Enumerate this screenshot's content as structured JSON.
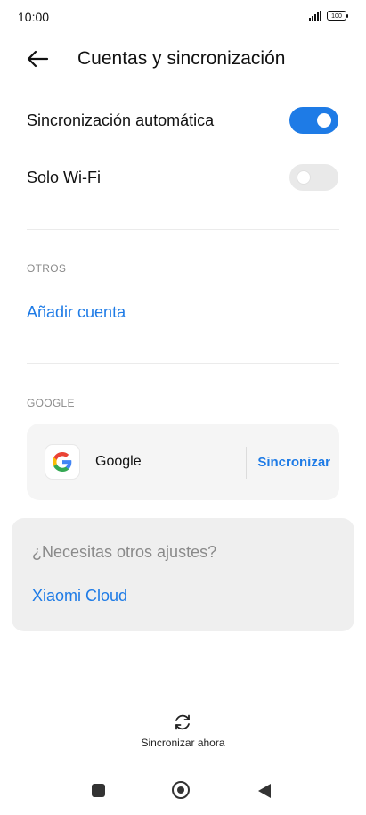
{
  "status_bar": {
    "time": "10:00",
    "battery": "100"
  },
  "header": {
    "title": "Cuentas y sincronización"
  },
  "settings": {
    "auto_sync": {
      "label": "Sincronización automática",
      "enabled": true
    },
    "wifi_only": {
      "label": "Solo Wi-Fi",
      "enabled": false
    }
  },
  "others": {
    "section_label": "OTROS",
    "add_account": "Añadir cuenta"
  },
  "google": {
    "section_label": "GOOGLE",
    "account_name": "Google",
    "sync_label": "Sincronizar"
  },
  "more_settings": {
    "question": "¿Necesitas otros ajustes?",
    "link": "Xiaomi Cloud"
  },
  "footer": {
    "sync_now": "Sincronizar ahora"
  },
  "colors": {
    "accent": "#1e7be6"
  }
}
